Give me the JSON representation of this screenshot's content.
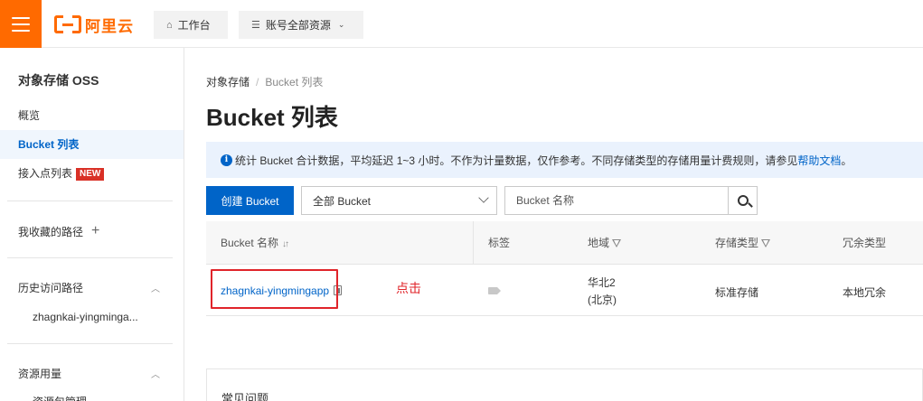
{
  "topbar": {
    "logo_text": "阿里云",
    "workbench_label": "工作台",
    "resources_label": "账号全部资源"
  },
  "sidebar": {
    "title": "对象存储 OSS",
    "items": [
      {
        "label": "概览",
        "active": false
      },
      {
        "label": "Bucket 列表",
        "active": true
      },
      {
        "label": "接入点列表",
        "active": false,
        "badge": "NEW"
      }
    ],
    "favorites_label": "我收藏的路径",
    "history_label": "历史访问路径",
    "history_items": [
      "zhagnkai-yingminga..."
    ],
    "usage_label": "资源用量",
    "usage_sub_label": "资源包管理"
  },
  "breadcrumb": {
    "root": "对象存储",
    "separator": "/",
    "current": "Bucket 列表"
  },
  "page_title": "Bucket 列表",
  "notice": {
    "text": "统计 Bucket 合计数据，平均延迟 1~3 小时。不作为计量数据，仅作参考。不同存储类型的存储用量计费规则，请参见",
    "link": "帮助文档",
    "end": "。"
  },
  "toolbar": {
    "create_button": "创建 Bucket",
    "filter_select": "全部 Bucket",
    "search_placeholder": "Bucket 名称"
  },
  "table": {
    "headers": {
      "name": "Bucket 名称",
      "tags": "标签",
      "region": "地域",
      "storage_class": "存储类型",
      "redundancy": "冗余类型"
    },
    "rows": [
      {
        "name": "zhagnkai-yingmingapp",
        "region_line1": "华北2",
        "region_line2": "(北京)",
        "storage_class": "标准存储",
        "redundancy": "本地冗余"
      }
    ]
  },
  "annotation": {
    "text": "点击",
    "color": "#e0242a"
  },
  "faq": {
    "title": "常见问题"
  },
  "colors": {
    "brand_orange": "#ff6a00",
    "primary_blue": "#0064c8",
    "badge_red": "#d93026"
  }
}
